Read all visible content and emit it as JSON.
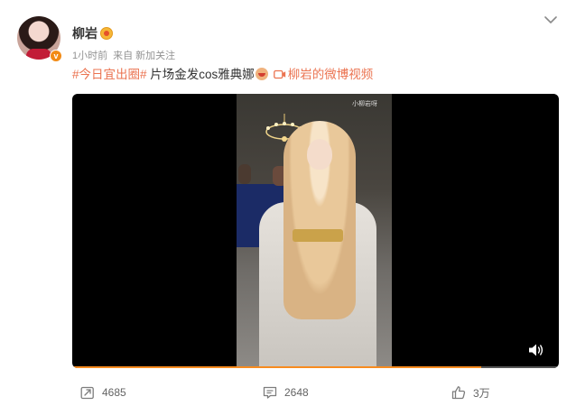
{
  "post": {
    "username": "柳岩",
    "time": "1小时前",
    "source": "来自 新加关注",
    "topic1": "#今日宜出圈#",
    "text": " 片场金发cos雅典娜",
    "video_link": "柳岩的微博视频"
  },
  "video": {
    "watermark": "小柳岩呀",
    "progress": 0.84
  },
  "actions": {
    "repost_count": "4685",
    "comment_count": "2648",
    "like_count": "3万"
  },
  "colors": {
    "topic": "#eb7350",
    "progress": "#f78b1f",
    "meta": "#939393",
    "verified_badge": "#f28b16"
  },
  "icons": {
    "menu": "chevron-down-icon",
    "repost": "repost-icon",
    "comment": "comment-icon",
    "like": "thumbs-up-icon",
    "volume": "volume-icon"
  }
}
